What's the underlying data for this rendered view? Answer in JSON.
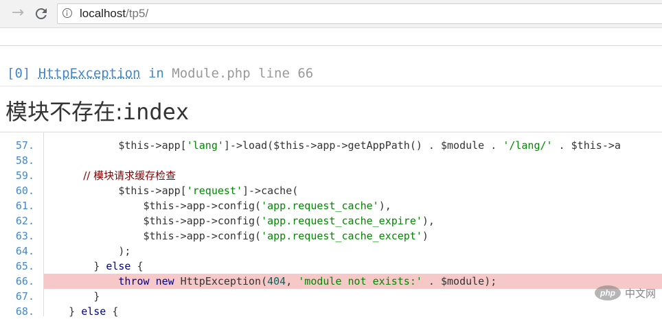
{
  "browser": {
    "url_host": "localhost",
    "url_path": "/tp5/"
  },
  "exception": {
    "index": "[0]",
    "class": "HttpException",
    "in": "in",
    "file": "Module.php",
    "line_label": "line",
    "line": "66",
    "title_cn": "模块不存在:",
    "title_module": "index"
  },
  "code": {
    "highlight_line": "66.",
    "lines": [
      {
        "no": "57.",
        "text": "            $this->app['lang']->load($this->app->getAppPath() . $module . '/lang/' . $this->a"
      },
      {
        "no": "58.",
        "text": ""
      },
      {
        "no": "59.",
        "text": "            // 模块请求缓存检查"
      },
      {
        "no": "60.",
        "text": "            $this->app['request']->cache("
      },
      {
        "no": "61.",
        "text": "                $this->app->config('app.request_cache'),"
      },
      {
        "no": "62.",
        "text": "                $this->app->config('app.request_cache_expire'),"
      },
      {
        "no": "63.",
        "text": "                $this->app->config('app.request_cache_except')"
      },
      {
        "no": "64.",
        "text": "            );"
      },
      {
        "no": "65.",
        "text": "        } else {"
      },
      {
        "no": "66.",
        "text": "            throw new HttpException(404, 'module not exists:' . $module);"
      },
      {
        "no": "67.",
        "text": "        }"
      },
      {
        "no": "68.",
        "text": "    } else {"
      }
    ]
  },
  "watermark": {
    "logo": "php",
    "text": "中文网"
  },
  "colors": {
    "link_blue": "#4288ce",
    "highlight": "#f7c8c8",
    "string_green": "#008800"
  }
}
